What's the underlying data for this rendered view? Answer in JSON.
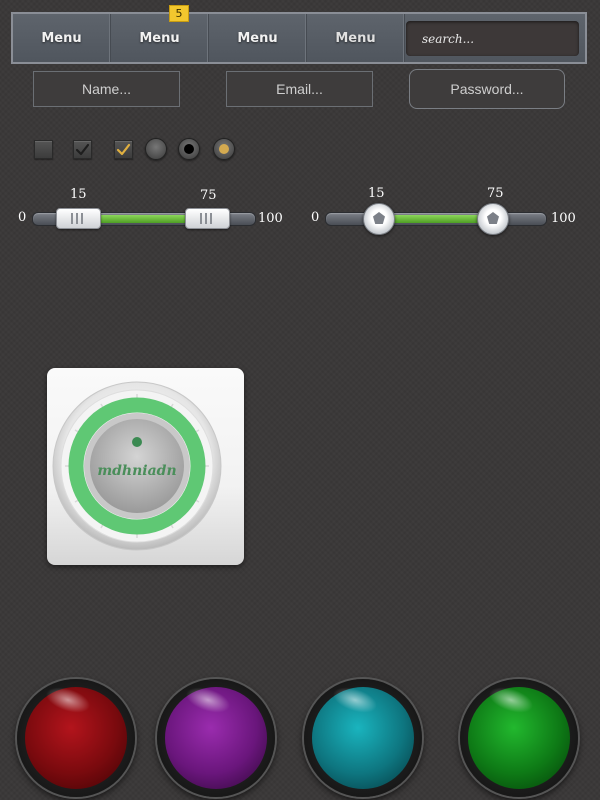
{
  "nav": {
    "items": [
      {
        "label": "Menu"
      },
      {
        "label": "Menu",
        "badge": "5"
      },
      {
        "label": "Menu"
      },
      {
        "label": "Menu"
      }
    ],
    "search_placeholder": "search..."
  },
  "form": {
    "name_placeholder": "Name...",
    "email_placeholder": "Email...",
    "password_placeholder": "Password..."
  },
  "checkboxes": [
    {
      "checked": false
    },
    {
      "checked": true,
      "check_color": "#2a2a2a"
    },
    {
      "checked": true,
      "check_color": "#e0b040"
    }
  ],
  "radios": [
    {
      "selected": false
    },
    {
      "selected": true,
      "dot_color": "#000000"
    },
    {
      "selected": true,
      "dot_color": "#d4aa50"
    }
  ],
  "slider_left": {
    "min": "0",
    "max": "100",
    "low": "15",
    "high": "75"
  },
  "slider_right": {
    "min": "0",
    "max": "100",
    "low": "15",
    "high": "75"
  },
  "knob": {
    "label": "mdhniadn",
    "ring_color": "#5fc874"
  },
  "orbs": [
    {
      "color": "#8a0c10"
    },
    {
      "color": "#7a1e8a"
    },
    {
      "color": "#148c96"
    },
    {
      "color": "#148c1e"
    }
  ]
}
